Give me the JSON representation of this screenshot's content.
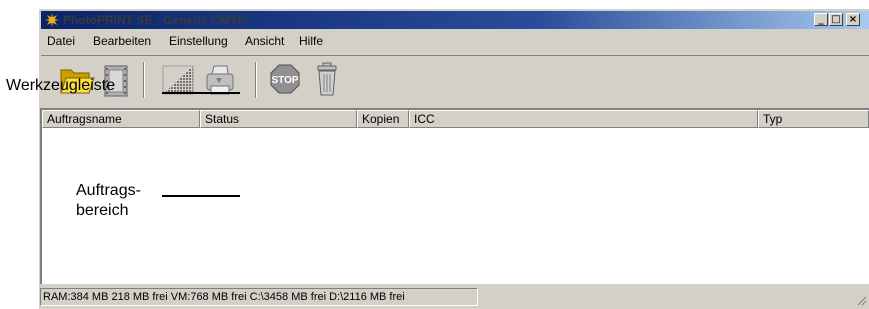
{
  "window": {
    "title": "PhotoPRINT SE - Generic CMYK",
    "controls": {
      "minimize": "_",
      "maximize": "□",
      "close": "×"
    }
  },
  "menu": [
    {
      "label": "Datei"
    },
    {
      "label": "Bearbeiten"
    },
    {
      "label": "Einstellung"
    },
    {
      "label": "Ansicht"
    },
    {
      "label": "Hilfe"
    }
  ],
  "toolbar": {
    "buttons": [
      {
        "icon": "folder-open-icon"
      },
      {
        "icon": "film-icon"
      },
      {
        "icon": "halftone-icon"
      },
      {
        "icon": "printer-icon"
      },
      {
        "icon": "stop-icon",
        "label": "STOP"
      },
      {
        "icon": "trash-icon"
      }
    ]
  },
  "job_list": {
    "columns": [
      "Auftragsname",
      "Status",
      "Kopien",
      "ICC",
      "Typ"
    ]
  },
  "status_bar": {
    "text": "RAM:384 MB 218 MB frei VM:768 MB frei C:\\3458 MB frei D:\\2116 MB frei"
  },
  "annotations": {
    "toolbar_label": "Werkzeugleiste",
    "job_area_label_line1": "Auftrags-",
    "job_area_label_line2": "bereich"
  }
}
